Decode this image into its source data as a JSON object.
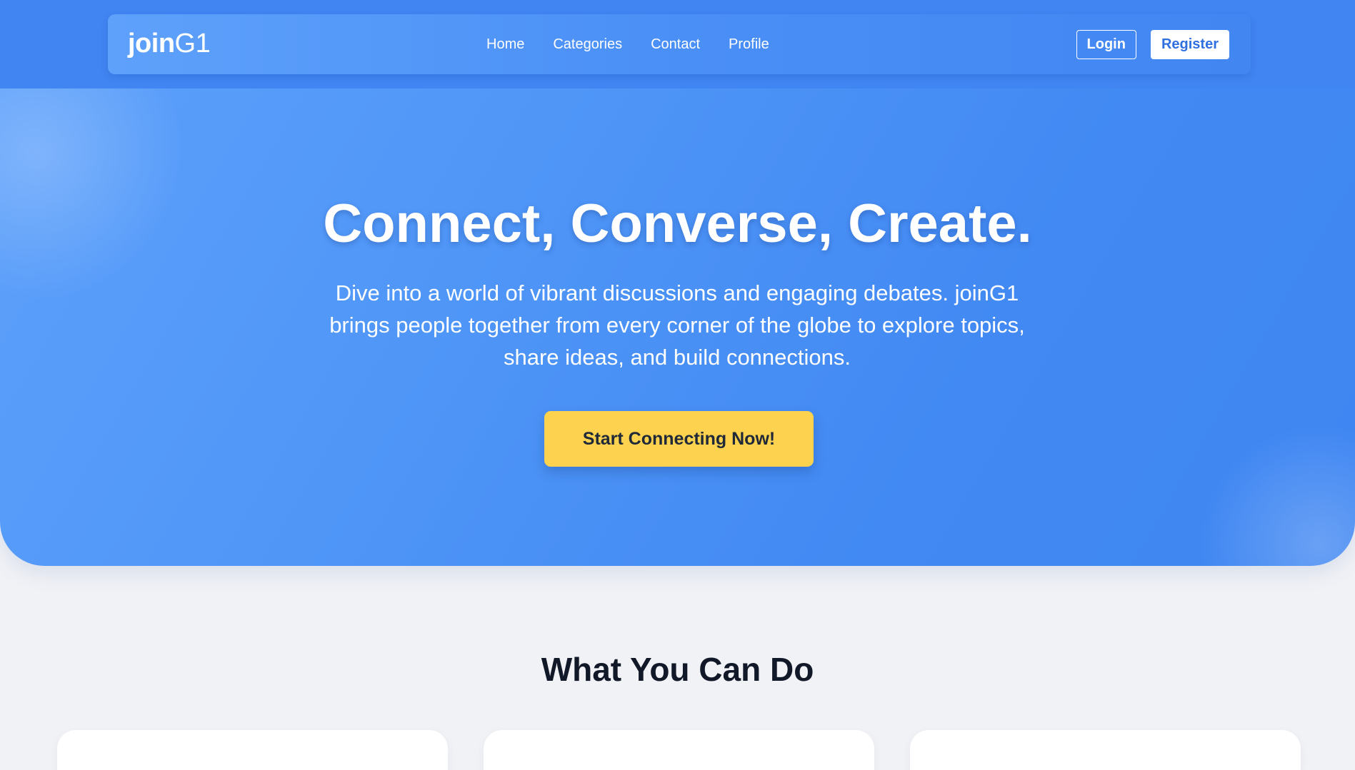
{
  "colors": {
    "primary_blue": "#4185f2",
    "hero_gradient_light": "#5da0fb",
    "cta_yellow": "#fdd24f",
    "page_background": "#f1f2f6",
    "heading_dark": "#111827"
  },
  "navbar": {
    "brand_bold": "join",
    "brand_light": "G1",
    "links": [
      "Home",
      "Categories",
      "Contact",
      "Profile"
    ],
    "login_label": "Login",
    "register_label": "Register"
  },
  "hero": {
    "title": "Connect, Converse, Create.",
    "subtitle": "Dive into a world of vibrant discussions and engaging debates. joinG1 brings people together from every corner of the globe to explore topics, share ideas, and build connections.",
    "cta_label": "Start Connecting Now!"
  },
  "features": {
    "title": "What You Can Do"
  }
}
